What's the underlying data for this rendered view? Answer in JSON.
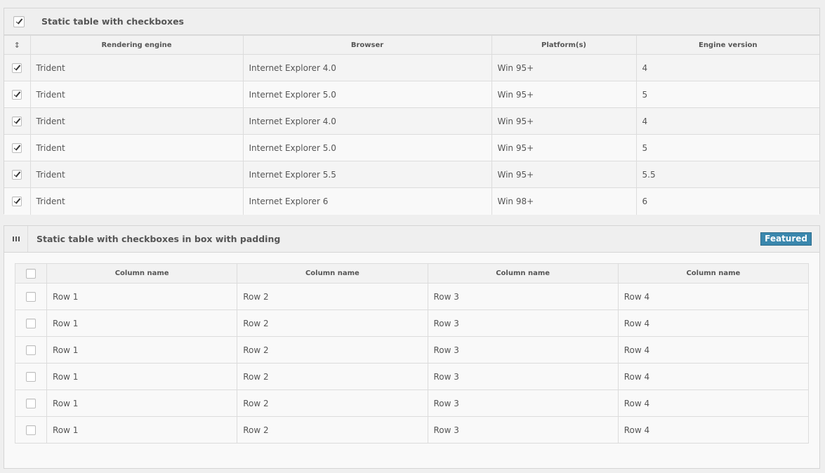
{
  "widget1": {
    "title": "Static table with checkboxes",
    "sort_glyph": "↕",
    "columns": [
      "Rendering engine",
      "Browser",
      "Platform(s)",
      "Engine version"
    ],
    "rows": [
      {
        "checked": true,
        "cells": [
          "Trident",
          "Internet Explorer 4.0",
          "Win 95+",
          "4"
        ]
      },
      {
        "checked": true,
        "cells": [
          "Trident",
          "Internet Explorer 5.0",
          "Win 95+",
          "5"
        ]
      },
      {
        "checked": true,
        "cells": [
          "Trident",
          "Internet Explorer 4.0",
          "Win 95+",
          "4"
        ]
      },
      {
        "checked": true,
        "cells": [
          "Trident",
          "Internet Explorer 5.0",
          "Win 95+",
          "5"
        ]
      },
      {
        "checked": true,
        "cells": [
          "Trident",
          "Internet Explorer 5.5",
          "Win 95+",
          "5.5"
        ]
      },
      {
        "checked": true,
        "cells": [
          "Trident",
          "Internet Explorer 6",
          "Win 98+",
          "6"
        ]
      }
    ]
  },
  "widget2": {
    "title": "Static table with checkboxes in box with padding",
    "badge": "Featured",
    "columns": [
      "Column name",
      "Column name",
      "Column name",
      "Column name"
    ],
    "rows": [
      {
        "checked": false,
        "cells": [
          "Row 1",
          "Row 2",
          "Row 3",
          "Row 4"
        ]
      },
      {
        "checked": false,
        "cells": [
          "Row 1",
          "Row 2",
          "Row 3",
          "Row 4"
        ]
      },
      {
        "checked": false,
        "cells": [
          "Row 1",
          "Row 2",
          "Row 3",
          "Row 4"
        ]
      },
      {
        "checked": false,
        "cells": [
          "Row 1",
          "Row 2",
          "Row 3",
          "Row 4"
        ]
      },
      {
        "checked": false,
        "cells": [
          "Row 1",
          "Row 2",
          "Row 3",
          "Row 4"
        ]
      },
      {
        "checked": false,
        "cells": [
          "Row 1",
          "Row 2",
          "Row 3",
          "Row 4"
        ]
      }
    ]
  }
}
